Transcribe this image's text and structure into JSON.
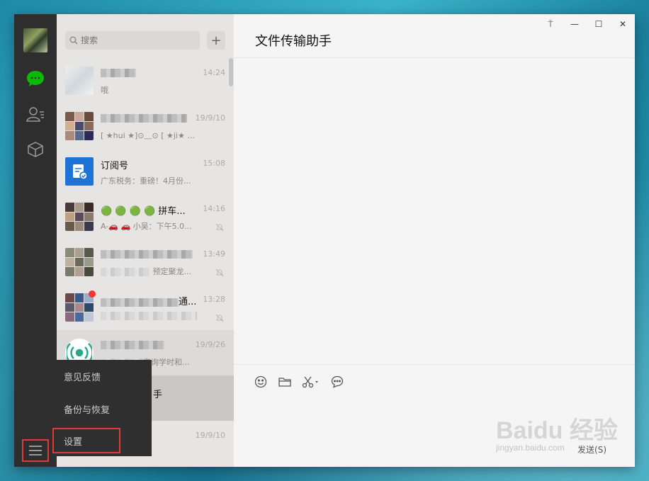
{
  "search": {
    "placeholder": "搜索"
  },
  "chat": {
    "title": "文件传输助手",
    "send_label": "发送(S)"
  },
  "window_controls": {
    "pin": "⍑",
    "minimize": "—",
    "maximize": "☐",
    "close": "✕"
  },
  "popup_menu": [
    {
      "label": "意见反馈"
    },
    {
      "label": "备份与恢复"
    },
    {
      "label": "设置"
    }
  ],
  "chats": [
    {
      "name": "",
      "time": "14:24",
      "message": "哦"
    },
    {
      "name": "",
      "time": "19/9/10",
      "message": "[ ★hui ★]⊙﹏⊙ [ ★ji★ ..."
    },
    {
      "name": "订阅号",
      "time": "15:08",
      "message": "广东税务：重磅！4月份..."
    },
    {
      "name": "🟢 🟢 🟢 🟢 拼车...",
      "time": "14:16",
      "message": "A-🚗 🚗 小吴：下午5.0..."
    },
    {
      "name": "",
      "time": "13:49",
      "message": "预定聚龙..."
    },
    {
      "name": "通...",
      "time": "13:28",
      "message": ""
    },
    {
      "name": "",
      "time": "19/9/26",
      "message": "音询学时和..."
    },
    {
      "name": "手",
      "time": "",
      "message": ""
    },
    {
      "name": "",
      "time": "19/9/10",
      "message": ""
    }
  ],
  "watermark": {
    "main": "Baidu 经验",
    "sub": "jingyan.baidu.com"
  }
}
